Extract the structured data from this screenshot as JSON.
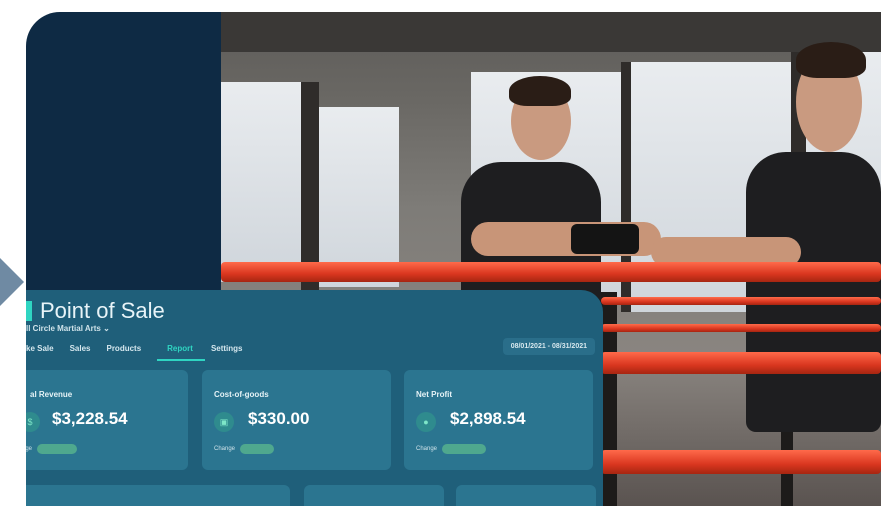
{
  "dashboard": {
    "title": "Point of Sale",
    "subtitle": "ll Circle Martial Arts",
    "subtitle_caret": "⌄",
    "nav": [
      "ke Sale",
      "Sales",
      "Products",
      "Report",
      "Settings"
    ],
    "active_nav_index": 3,
    "date_range": "08/01/2021 - 08/31/2021",
    "metrics": [
      {
        "label": "al Revenue",
        "value": "$3,228.54",
        "change_label": "nge"
      },
      {
        "label": "Cost-of-goods",
        "value": "$330.00",
        "change_label": "Change"
      },
      {
        "label": "Net Profit",
        "value": "$2,898.54",
        "change_label": "Change"
      }
    ]
  },
  "colors": {
    "hero_bg": "#0e2a44",
    "dashboard_bg": "#1f5f7a",
    "card_bg": "#2b7590",
    "accent": "#2fd5c2",
    "ring_rope": "#d9361f"
  }
}
